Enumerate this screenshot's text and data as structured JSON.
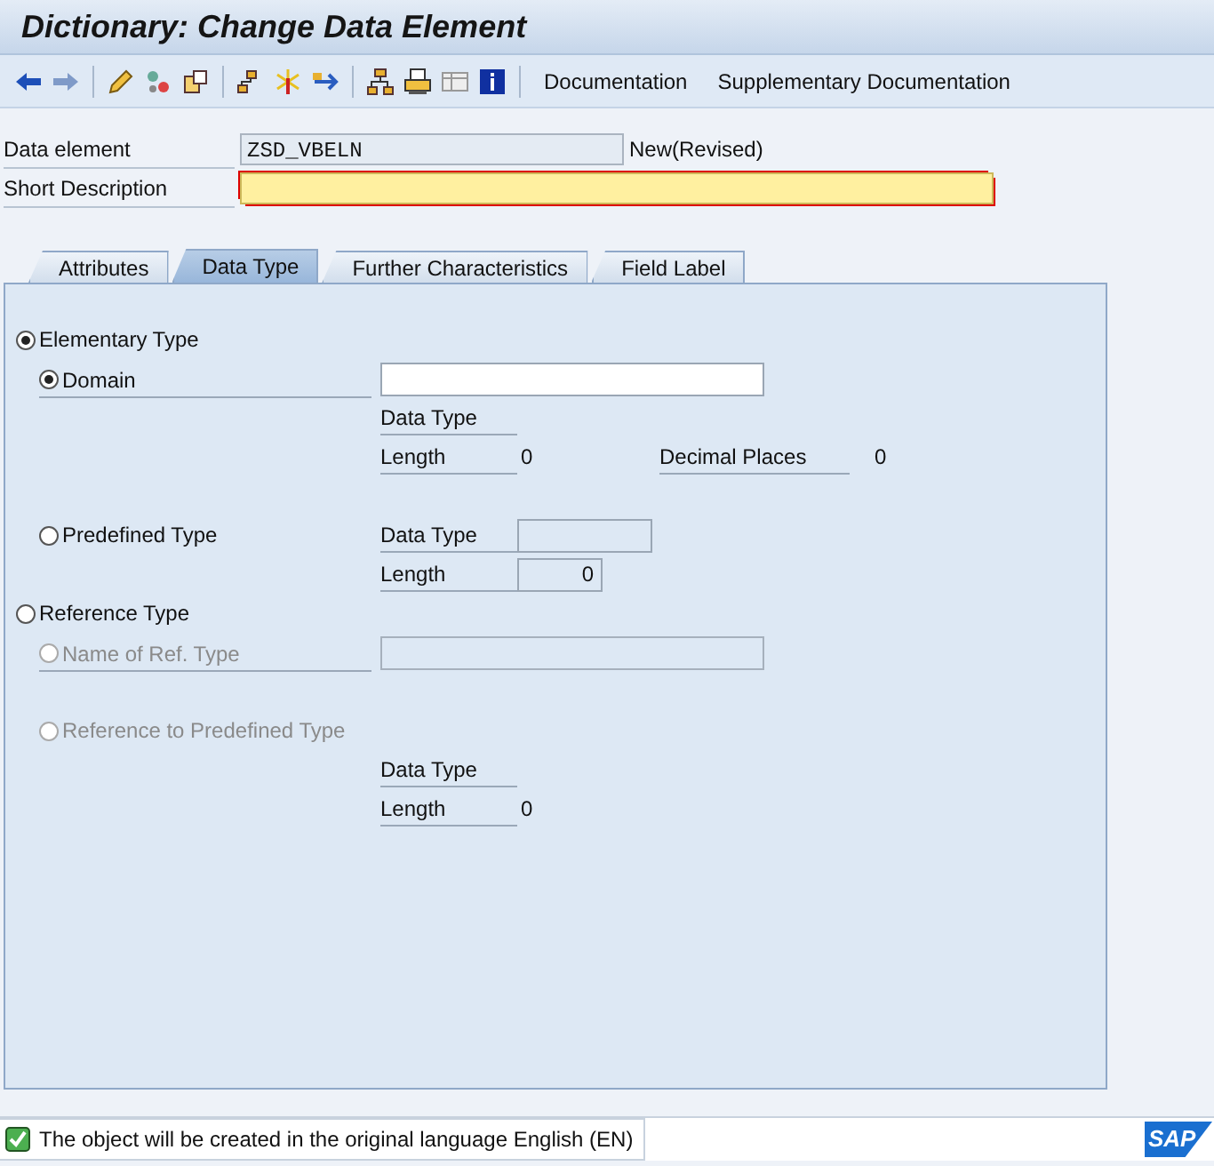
{
  "window": {
    "title": "Dictionary: Change Data Element"
  },
  "toolbar": {
    "buttons": [
      "Documentation",
      "Supplementary Documentation"
    ]
  },
  "header": {
    "data_element": {
      "label": "Data element",
      "value": "ZSD_VBELN",
      "status": "New(Revised)"
    },
    "short_description": {
      "label": "Short Description",
      "required": true
    }
  },
  "tabs": [
    {
      "label": "Attributes",
      "selected": false
    },
    {
      "label": "Data Type",
      "selected": true
    },
    {
      "label": "Further Characteristics",
      "selected": false
    },
    {
      "label": "Field Label",
      "selected": false
    }
  ],
  "elementary_type": {
    "label": "Elementary Type",
    "selected": true,
    "domain": {
      "label": "Domain",
      "selected": true,
      "data_type_label": "Data Type",
      "length_label": "Length",
      "length_value": "0",
      "decimal_label": "Decimal Places",
      "decimal_value": "0"
    },
    "predefined": {
      "label": "Predefined Type",
      "selected": false,
      "data_type_label": "Data Type",
      "length_label": "Length",
      "length_value": "0"
    }
  },
  "reference_type": {
    "label": "Reference Type",
    "selected": false,
    "name_of_ref": {
      "label": "Name of Ref. Type",
      "selected": false,
      "disabled": true
    },
    "ref_predefined": {
      "label": "Reference to Predefined Type",
      "selected": false,
      "disabled": true,
      "data_type_label": "Data Type",
      "length_label": "Length",
      "length_value": "0"
    }
  },
  "status_bar": {
    "success": true,
    "message": "The object will be created in the original language English (EN)",
    "logo": "SAP"
  }
}
